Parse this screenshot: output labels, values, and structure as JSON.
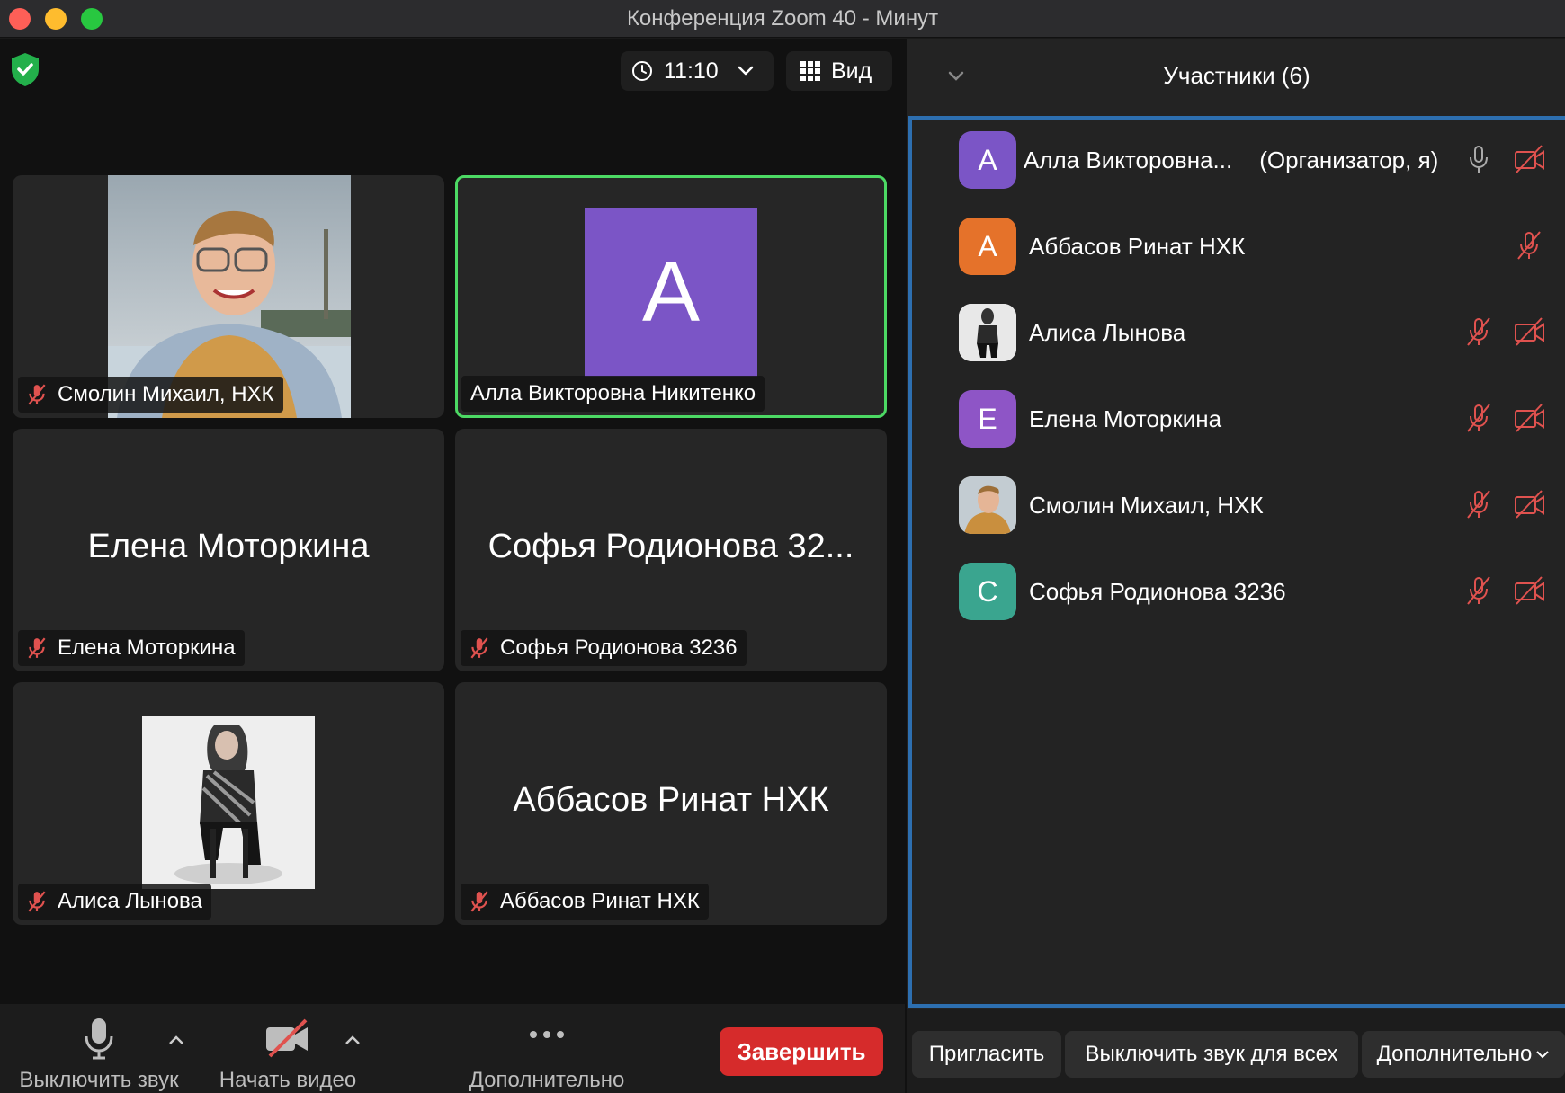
{
  "window": {
    "title": "Конференция Zoom   40 - Минут"
  },
  "header": {
    "time": "11:10",
    "view_label": "Вид"
  },
  "tiles": [
    {
      "label": "Смолин Михаил, НХК",
      "big": "",
      "kind": "photo-man"
    },
    {
      "label": "Алла Викторовна Никитенко",
      "big": "",
      "kind": "avatar",
      "letter": "A",
      "active": true
    },
    {
      "label": "Елена Моторкина",
      "big": "Елена Моторкина"
    },
    {
      "label": "Софья Родионова 3236",
      "big": "Софья Родионова 32..."
    },
    {
      "label": "Алиса Лынова",
      "big": "",
      "kind": "photo-woman"
    },
    {
      "label": "Аббасов Ринат НХК",
      "big": "Аббасов Ринат НХК"
    }
  ],
  "toolbar": {
    "mute_label": "Выключить звук",
    "video_label": "Начать видео",
    "more_label": "Дополнительно",
    "end_label": "Завершить"
  },
  "participants": {
    "title": "Участники (6)",
    "items": [
      {
        "name": "Алла Викторовна...",
        "role": "(Организатор, я)",
        "initial": "A",
        "color": "#7b55c6"
      },
      {
        "name": "Аббасов Ринат НХК",
        "initial": "A",
        "color": "#e5722a"
      },
      {
        "name": "Алиса Лынова",
        "initial": "",
        "color": "#dcdcdc"
      },
      {
        "name": "Елена Моторкина",
        "initial": "E",
        "color": "#8e55c6"
      },
      {
        "name": "Смолин Михаил, НХК",
        "initial": "",
        "color": "#9a8a70"
      },
      {
        "name": "Софья Родионова 3236",
        "initial": "C",
        "color": "#3aa58f"
      }
    ],
    "buttons": {
      "invite": "Пригласить",
      "mute_all": "Выключить звук для всех",
      "more": "Дополнительно"
    }
  },
  "colors": {
    "active_speaker": "#4cd964",
    "end_button": "#d62b2b",
    "muted_icon": "#e0524f",
    "panel_focus": "#2d6fb0"
  }
}
